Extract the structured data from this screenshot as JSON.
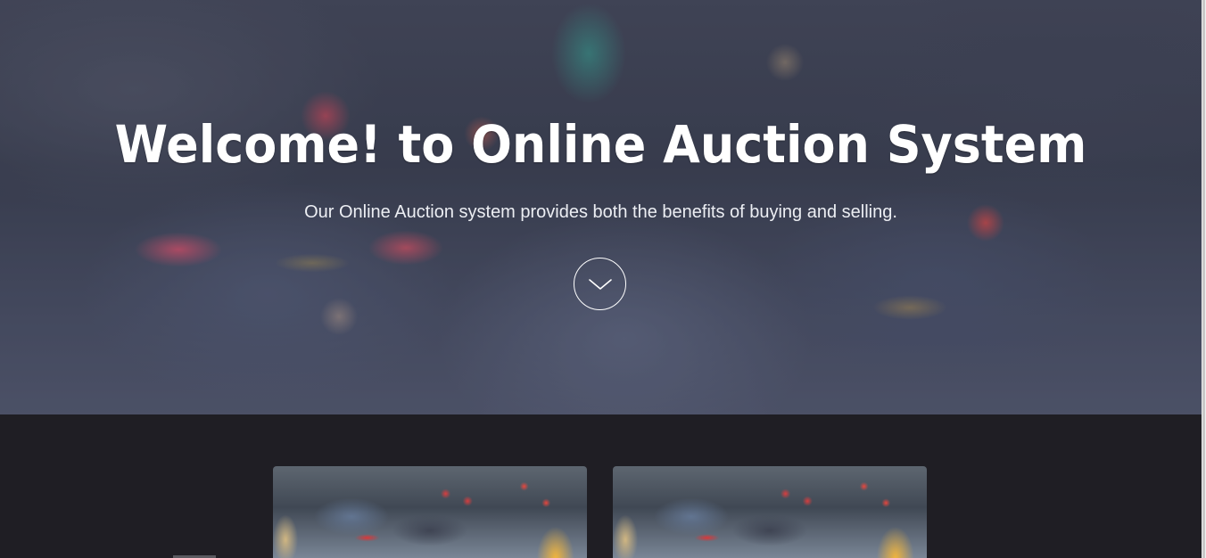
{
  "hero": {
    "title": "Welcome! to Online Auction System",
    "subtitle": "Our Online Auction system provides both the benefits of buying and selling.",
    "scroll_icon": "chevron-down-icon"
  },
  "cards": [
    {
      "image": "traffic-photo"
    },
    {
      "image": "traffic-photo"
    }
  ],
  "colors": {
    "section_background": "#1f1e24",
    "hero_text": "#ffffff"
  }
}
